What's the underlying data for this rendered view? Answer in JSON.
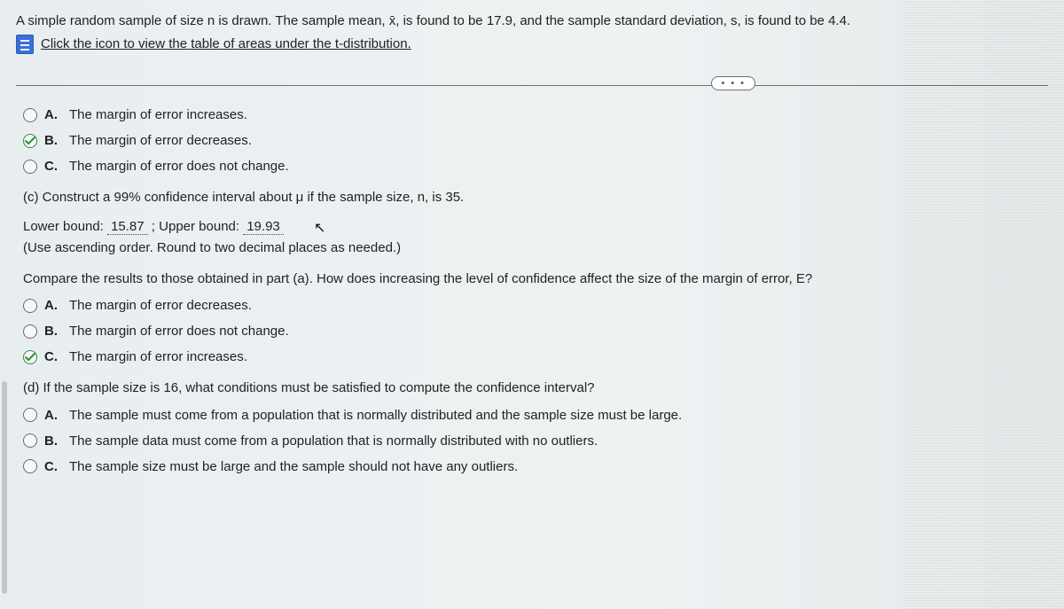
{
  "intro": {
    "line1": "A simple random sample of size n is drawn. The sample mean, x̄, is found to be 17.9, and the sample standard deviation, s, is found to be 4.4.",
    "link_text": "Click the icon to view the table of areas under the t-distribution."
  },
  "divider_badge": "• • •",
  "part_b": {
    "options": [
      {
        "letter": "A.",
        "text": "The margin of error increases.",
        "checked": false
      },
      {
        "letter": "B.",
        "text": "The margin of error decreases.",
        "checked": true
      },
      {
        "letter": "C.",
        "text": "The margin of error does not change.",
        "checked": false
      }
    ]
  },
  "part_c": {
    "prompt": "(c) Construct a 99% confidence interval about μ if the sample size, n, is 35.",
    "lower_label": "Lower bound:",
    "lower_value": "15.87",
    "sep": ";",
    "upper_label": "Upper bound:",
    "upper_value": "19.93",
    "note": "(Use ascending order. Round to two decimal places as needed.)",
    "compare": "Compare the results to those obtained in part (a). How does increasing the level of confidence affect the size of the margin of error, E?",
    "options": [
      {
        "letter": "A.",
        "text": "The margin of error decreases.",
        "checked": false
      },
      {
        "letter": "B.",
        "text": "The margin of error does not change.",
        "checked": false
      },
      {
        "letter": "C.",
        "text": "The margin of error increases.",
        "checked": true
      }
    ]
  },
  "part_d": {
    "prompt": "(d) If the sample size is 16, what conditions must be satisfied to compute the confidence interval?",
    "options": [
      {
        "letter": "A.",
        "text": "The sample must come from a population that is normally distributed and the sample size must be large.",
        "checked": false
      },
      {
        "letter": "B.",
        "text": "The sample data must come from a population that is normally distributed with no outliers.",
        "checked": false
      },
      {
        "letter": "C.",
        "text": "The sample size must be large and the sample should not have any outliers.",
        "checked": false
      }
    ]
  }
}
